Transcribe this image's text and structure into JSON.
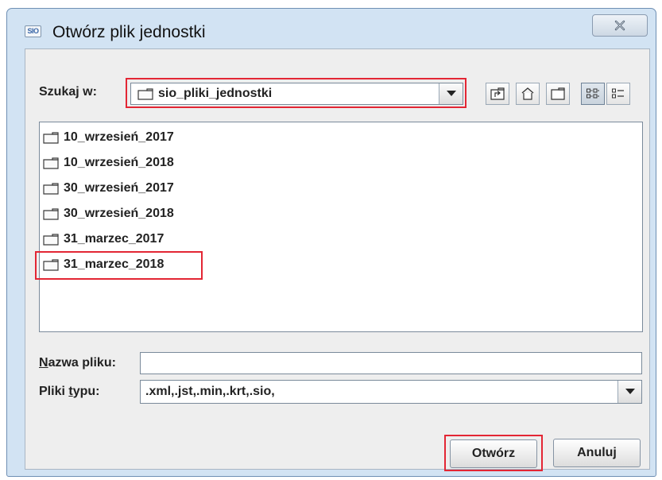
{
  "window": {
    "app_icon_text": "SIO",
    "title": "Otwórz plik jednostki",
    "close_glyph": "X"
  },
  "lookin": {
    "label": "Szukaj w:",
    "value": "sio_pliki_jednostki"
  },
  "toolbar": {
    "buttons": [
      "up-one-level",
      "home",
      "new-folder",
      "list-view",
      "details-view"
    ]
  },
  "files": [
    {
      "name": "10_wrzesień_2017",
      "icon": "folder-icon"
    },
    {
      "name": "10_wrzesień_2018",
      "icon": "folder-icon"
    },
    {
      "name": "30_wrzesień_2017",
      "icon": "folder-icon"
    },
    {
      "name": "30_wrzesień_2018",
      "icon": "folder-icon"
    },
    {
      "name": "31_marzec_2017",
      "icon": "folder-icon"
    },
    {
      "name": "31_marzec_2018",
      "icon": "folder-icon"
    }
  ],
  "filename": {
    "label_mnemonic": "N",
    "label_rest": "azwa pliku:",
    "value": ""
  },
  "filetype": {
    "label_start": "Pliki ",
    "label_mnemonic": "t",
    "label_rest": "ypu:",
    "value": ".xml,.jst,.min,.krt,.sio,"
  },
  "buttons": {
    "open": "Otwórz",
    "cancel": "Anuluj"
  },
  "colors": {
    "highlight": "#e32634",
    "title_bar": "#d2e3f3",
    "dialog_bg": "#eeeeee"
  }
}
